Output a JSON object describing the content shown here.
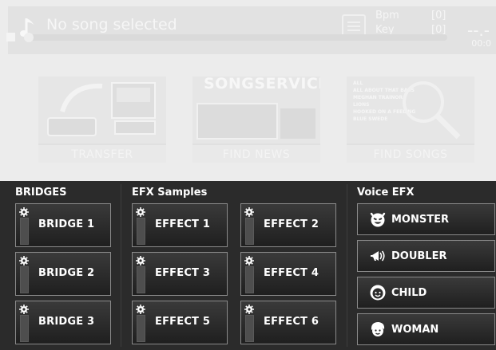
{
  "player": {
    "song_title": "No song selected",
    "bpm_label": "Bpm",
    "bpm_value": "[0]",
    "key_label": "Key",
    "key_value": "[0]",
    "time_display": "--.-",
    "time_elapsed": "00:0"
  },
  "tiles": [
    {
      "caption": "TRANSFER"
    },
    {
      "caption": "FIND NEWS",
      "brand": "SONGSERVICE"
    },
    {
      "caption": "FIND SONGS",
      "art_lines": [
        "ALL",
        "ALL ABOUT THAT BASS",
        "MEGHAN TRAINOR",
        "LIONS",
        "HOOKED ON A FEELING",
        "BLUE SWEDE"
      ]
    }
  ],
  "bridges": {
    "title": "BRIDGES",
    "items": [
      "BRIDGE 1",
      "BRIDGE 2",
      "BRIDGE 3"
    ]
  },
  "efx_samples": {
    "title": "EFX Samples",
    "items": [
      "EFFECT 1",
      "EFFECT 2",
      "EFFECT 3",
      "EFFECT 4",
      "EFFECT 5",
      "EFFECT 6"
    ]
  },
  "voice_efx": {
    "title": "Voice EFX",
    "items": [
      {
        "label": "MONSTER",
        "icon": "monster-face-icon"
      },
      {
        "label": "DOUBLER",
        "icon": "megaphone-icon"
      },
      {
        "label": "CHILD",
        "icon": "child-face-icon"
      },
      {
        "label": "WOMAN",
        "icon": "woman-face-icon"
      }
    ]
  },
  "colors": {
    "panel_bg": "#2b2b2b",
    "button_border": "#8a8a8a",
    "text": "#ffffff"
  }
}
